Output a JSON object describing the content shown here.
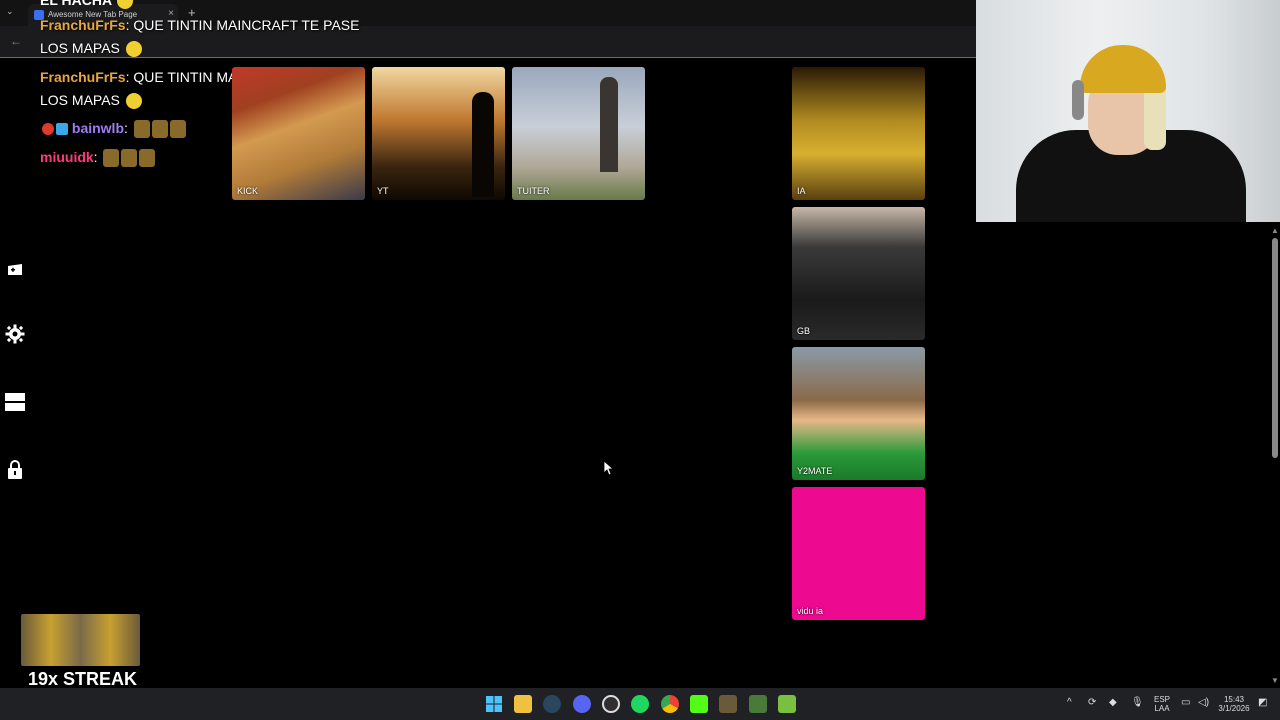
{
  "browser": {
    "tab_title": "Awesome New Tab Page",
    "tab_close": "×",
    "new_tab": "+",
    "tab_dropdown": "⌄",
    "back": "←"
  },
  "chat": {
    "top_partial": "EL HACHA",
    "messages": [
      {
        "user": "FranchuFrFs",
        "text": "QUE TINTIN MAINCRAFT TE PASE",
        "cont": "LOS MAPAS"
      },
      {
        "user": "FranchuFrFs",
        "text": "QUE TINTIN MAINCRAFT TE PASE",
        "cont": "LOS MAPAS"
      },
      {
        "user": "bainwlb",
        "text": ""
      },
      {
        "user": "miuuidk",
        "text": ""
      }
    ]
  },
  "tiles": [
    {
      "label": "KICK"
    },
    {
      "label": "YT"
    },
    {
      "label": "TUITER"
    },
    {
      "label": "IA"
    },
    {
      "label": "GB"
    },
    {
      "label": "Y2MATE"
    },
    {
      "label": "vidu ia"
    }
  ],
  "sidebar": {
    "icons": [
      "gamepad-icon",
      "gear-icon",
      "layout-icon",
      "lock-icon"
    ]
  },
  "streak": {
    "text": "19x STREAK"
  },
  "taskbar": {
    "apps": [
      "windows-start-icon",
      "file-explorer-icon",
      "steam-icon",
      "discord-icon",
      "obs-icon",
      "spotify-icon",
      "chrome-icon",
      "kick-icon",
      "minecraft-icon",
      "minecraft-launcher-icon",
      "minecraft-alt-icon"
    ],
    "lang_top": "ESP",
    "lang_bottom": "LAA",
    "time": "15:43",
    "date": "3/1/2026"
  },
  "colors": {
    "vidu_tile": "#ed0990",
    "username_orange": "#e8a640",
    "username_purple": "#9f7cf2",
    "username_pink": "#ff3a7a"
  }
}
